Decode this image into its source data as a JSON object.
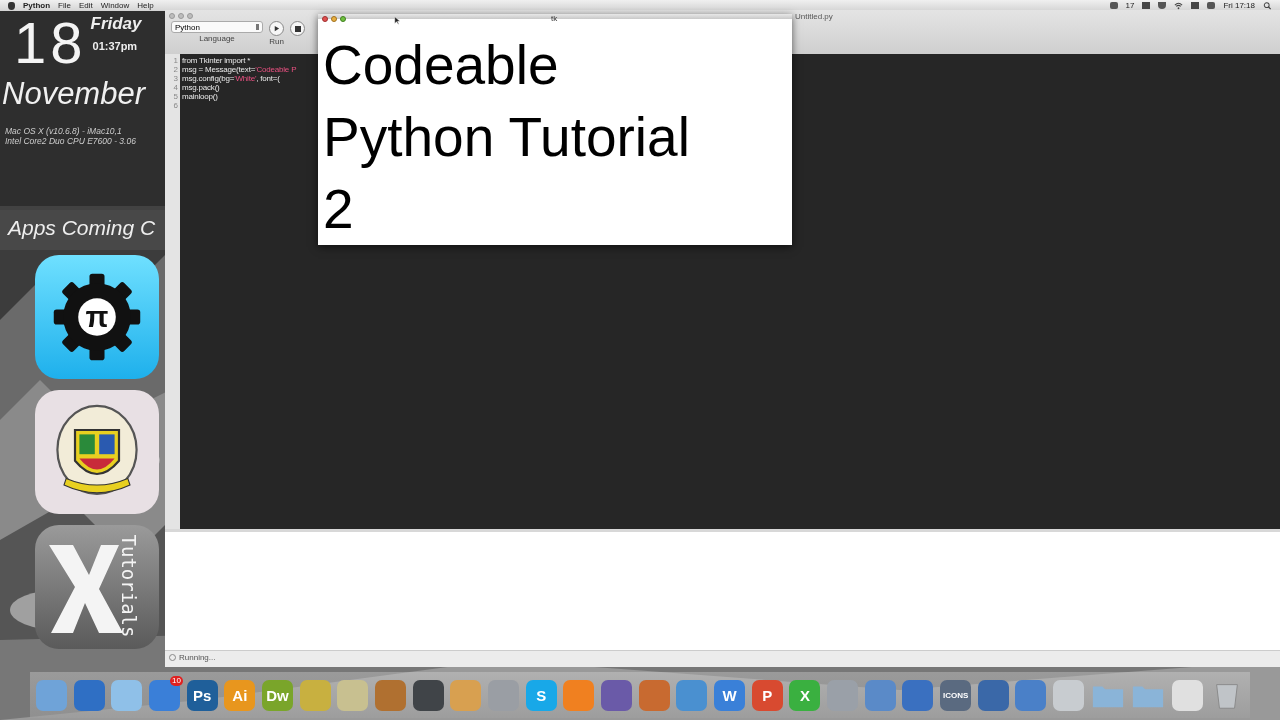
{
  "menu_bar": {
    "app": "Python",
    "items": [
      "File",
      "Edit",
      "Window",
      "Help"
    ],
    "status_count": "17",
    "clock": "Fri 17:18"
  },
  "widgets": {
    "day_number": "18",
    "weekday": "Friday",
    "time": "01:37pm",
    "month": "November",
    "system_lines": [
      "Mac OS X (v10.6.8) - iMac10,1",
      "Intel Core2 Duo CPU E7600 - 3.06"
    ],
    "apps_heading": "Apps Coming C",
    "apps": [
      {
        "kind": "pi",
        "glyph": "π"
      },
      {
        "kind": "crest"
      },
      {
        "kind": "tutorials",
        "label": "Tutorials"
      }
    ]
  },
  "editor": {
    "title": "Untitled.py",
    "language": "Python",
    "language_caption": "Language",
    "run_caption": "Run",
    "line_numbers": [
      "1",
      "2",
      "3",
      "4",
      "5",
      "6"
    ],
    "code": [
      [
        {
          "text": "from Tkinter import *",
          "kind": "plain"
        }
      ],
      [
        {
          "text": "msg = Message(text=",
          "kind": "plain"
        },
        {
          "text": "'Codeable P",
          "kind": "string"
        }
      ],
      [
        {
          "text": "msg.config(bg=",
          "kind": "plain"
        },
        {
          "text": "'White'",
          "kind": "string"
        },
        {
          "text": ", font=(",
          "kind": "plain"
        }
      ],
      [
        {
          "text": "msg.pack()",
          "kind": "plain"
        }
      ],
      [
        {
          "text": "mainloop()",
          "kind": "plain"
        }
      ]
    ],
    "status": "Running..."
  },
  "tk_window": {
    "title": "tk",
    "lines": [
      "Codeable",
      "Python Tutorial",
      "2"
    ]
  },
  "dock": [
    {
      "kind": "app",
      "color": "#6fa3d8"
    },
    {
      "kind": "app",
      "color": "#2f6fc4"
    },
    {
      "kind": "app",
      "color": "#8fc0e8"
    },
    {
      "kind": "app",
      "color": "#3a7fd8",
      "badge": "10"
    },
    {
      "kind": "app",
      "color": "#1f5f9a",
      "label": "Ps"
    },
    {
      "kind": "app",
      "color": "#e8961e",
      "label": "Ai"
    },
    {
      "kind": "app",
      "color": "#7aa52a",
      "label": "Dw"
    },
    {
      "kind": "app",
      "color": "#c8b040"
    },
    {
      "kind": "app",
      "color": "#c8c090"
    },
    {
      "kind": "app",
      "color": "#b07030"
    },
    {
      "kind": "app",
      "color": "#404448"
    },
    {
      "kind": "app",
      "color": "#d8a050"
    },
    {
      "kind": "app",
      "color": "#9a9ea4"
    },
    {
      "kind": "app",
      "color": "#18a8e8",
      "label": "S"
    },
    {
      "kind": "app",
      "color": "#f08020"
    },
    {
      "kind": "app",
      "color": "#6a5aa8"
    },
    {
      "kind": "app",
      "color": "#c86a30"
    },
    {
      "kind": "app",
      "color": "#4a90d0"
    },
    {
      "kind": "app",
      "color": "#3a80d8",
      "label": "W"
    },
    {
      "kind": "app",
      "color": "#d84a30",
      "label": "P"
    },
    {
      "kind": "app",
      "color": "#3ab040",
      "label": "X"
    },
    {
      "kind": "app",
      "color": "#9aa0a8"
    },
    {
      "kind": "app",
      "color": "#5a8ac8"
    },
    {
      "kind": "app",
      "color": "#3a70c0"
    },
    {
      "kind": "app",
      "color": "#5a6a80",
      "label": "ICONS"
    },
    {
      "kind": "app",
      "color": "#3a68a8"
    },
    {
      "kind": "app",
      "color": "#4a80c8"
    },
    {
      "kind": "app",
      "color": "#c8ccd0"
    },
    {
      "kind": "folder",
      "color": "#8ab4d8"
    },
    {
      "kind": "folder",
      "color": "#8ab4d8"
    },
    {
      "kind": "app",
      "color": "#e0e0e0"
    },
    {
      "kind": "trash",
      "color": "#c0c4c8"
    }
  ]
}
